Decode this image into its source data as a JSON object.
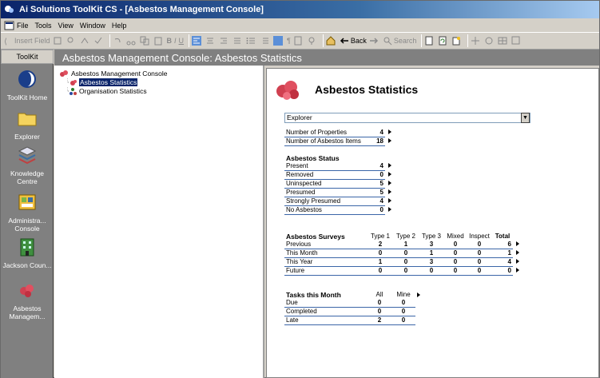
{
  "window": {
    "title": "Ai Solutions ToolKit CS - [Asbestos Management Console]"
  },
  "menu": [
    {
      "label": "File",
      "key": "F"
    },
    {
      "label": "Tools",
      "key": ""
    },
    {
      "label": "View",
      "key": "V"
    },
    {
      "label": "Window",
      "key": "W"
    },
    {
      "label": "Help",
      "key": "H"
    }
  ],
  "toolbar": {
    "insert_field": "Insert Field",
    "back": "Back",
    "search": "Search"
  },
  "sidebar": {
    "header": "ToolKit",
    "items": [
      {
        "label": "ToolKit Home",
        "icon": "toolkit-home-icon"
      },
      {
        "label": "Explorer",
        "icon": "folder-icon"
      },
      {
        "label": "Knowledge Centre",
        "icon": "books-icon"
      },
      {
        "label": "Administra... Console",
        "icon": "admin-console-icon"
      },
      {
        "label": "Jackson Coun...",
        "icon": "building-icon"
      },
      {
        "label": "Asbestos Managem...",
        "icon": "asbestos-icon"
      }
    ]
  },
  "page_title": "Asbestos Management Console: Asbestos Statistics",
  "tree": {
    "root": "Asbestos Management Console",
    "children": [
      "Asbestos Statistics",
      "Organisation Statistics"
    ]
  },
  "content": {
    "heading": "Asbestos Statistics",
    "selector_value": "Explorer",
    "summary": [
      {
        "label": "Number of Properties",
        "value": "4"
      },
      {
        "label": "Number of Asbestos Items",
        "value": "18"
      }
    ],
    "status": {
      "title": "Asbestos Status",
      "rows": [
        {
          "label": "Present",
          "value": "4"
        },
        {
          "label": "Removed",
          "value": "0"
        },
        {
          "label": "Uninspected",
          "value": "5"
        },
        {
          "label": "Presumed",
          "value": "5"
        },
        {
          "label": "Strongly Presumed",
          "value": "4"
        },
        {
          "label": "No Asbestos",
          "value": "0"
        }
      ]
    },
    "surveys": {
      "title": "Asbestos Surveys",
      "columns": [
        "Type 1",
        "Type 2",
        "Type 3",
        "Mixed",
        "Inspect",
        "Total"
      ],
      "rows": [
        {
          "label": "Previous",
          "values": [
            "2",
            "1",
            "3",
            "0",
            "0",
            "6"
          ]
        },
        {
          "label": "This Month",
          "values": [
            "0",
            "0",
            "1",
            "0",
            "0",
            "1"
          ]
        },
        {
          "label": "This Year",
          "values": [
            "1",
            "0",
            "3",
            "0",
            "0",
            "4"
          ]
        },
        {
          "label": "Future",
          "values": [
            "0",
            "0",
            "0",
            "0",
            "0",
            "0"
          ]
        }
      ]
    },
    "tasks": {
      "title": "Tasks this Month",
      "columns": [
        "All",
        "Mine"
      ],
      "rows": [
        {
          "label": "Due",
          "values": [
            "0",
            "0"
          ]
        },
        {
          "label": "Completed",
          "values": [
            "0",
            "0"
          ]
        },
        {
          "label": "Late",
          "values": [
            "2",
            "0"
          ]
        }
      ]
    }
  }
}
